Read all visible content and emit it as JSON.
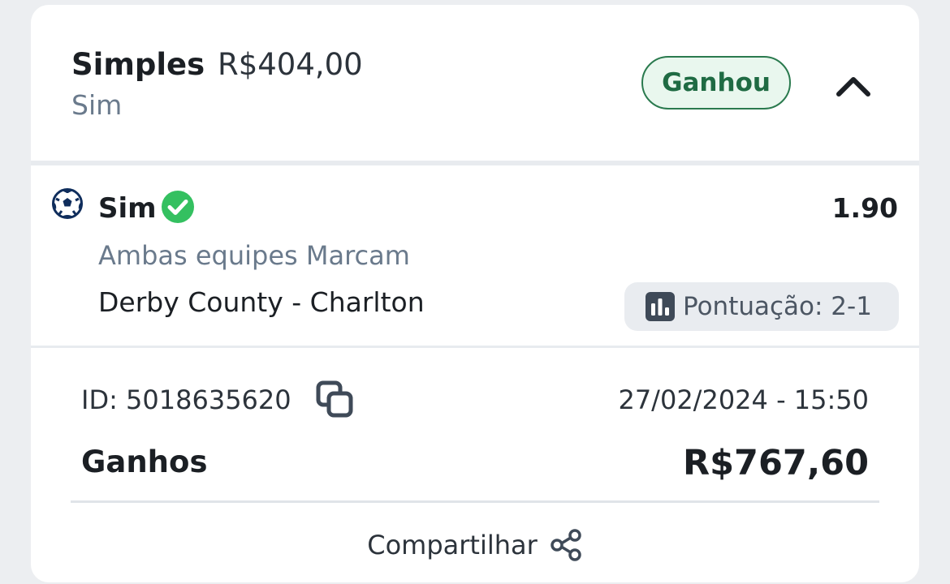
{
  "bet": {
    "type": "Simples",
    "stake": "R$404,00",
    "selection_summary": "Sim",
    "status": "Ganhou",
    "colors": {
      "status_bg": "#e9f7ee",
      "status_text": "#1f6b43",
      "check": "#34c060"
    }
  },
  "selection": {
    "sport_icon": "soccer-ball-icon",
    "name": "Sim",
    "result_icon": "check-circle-icon",
    "odds": "1.90",
    "market": "Ambas equipes Marcam",
    "event": "Derby County - Charlton",
    "score_icon": "bar-chart-icon",
    "score": "Pontuação: 2-1"
  },
  "footer": {
    "id": "ID: 5018635620",
    "copy_icon": "copy-icon",
    "datetime": "27/02/2024 - 15:50",
    "winnings_label": "Ganhos",
    "winnings_value": "R$767,60",
    "share_label": "Compartilhar",
    "share_icon": "share-icon"
  }
}
